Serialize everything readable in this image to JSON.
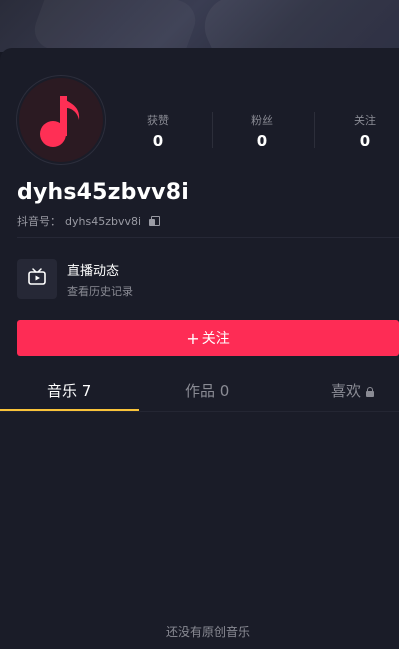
{
  "profile": {
    "username": "dyhs45zbvv8i",
    "douyin_id_label": "抖音号：",
    "douyin_id": "dyhs45zbvv8i"
  },
  "stats": [
    {
      "label": "获赞",
      "value": "0"
    },
    {
      "label": "粉丝",
      "value": "0"
    },
    {
      "label": "关注",
      "value": "0"
    }
  ],
  "live": {
    "title": "直播动态",
    "subtitle": "查看历史记录"
  },
  "follow_button": {
    "plus": "+",
    "label": "关注"
  },
  "tabs": [
    {
      "label": "音乐 7"
    },
    {
      "label": "作品 0"
    },
    {
      "label": "喜欢"
    }
  ],
  "empty_state": "还没有原创音乐",
  "colors": {
    "accent": "#fe2c55",
    "tab_indicator": "#f9c33a",
    "background": "#1a1c28"
  },
  "icons": {
    "avatar": "music-note-icon",
    "copy": "copy-icon",
    "live": "tv-play-icon",
    "lock": "lock-icon"
  }
}
